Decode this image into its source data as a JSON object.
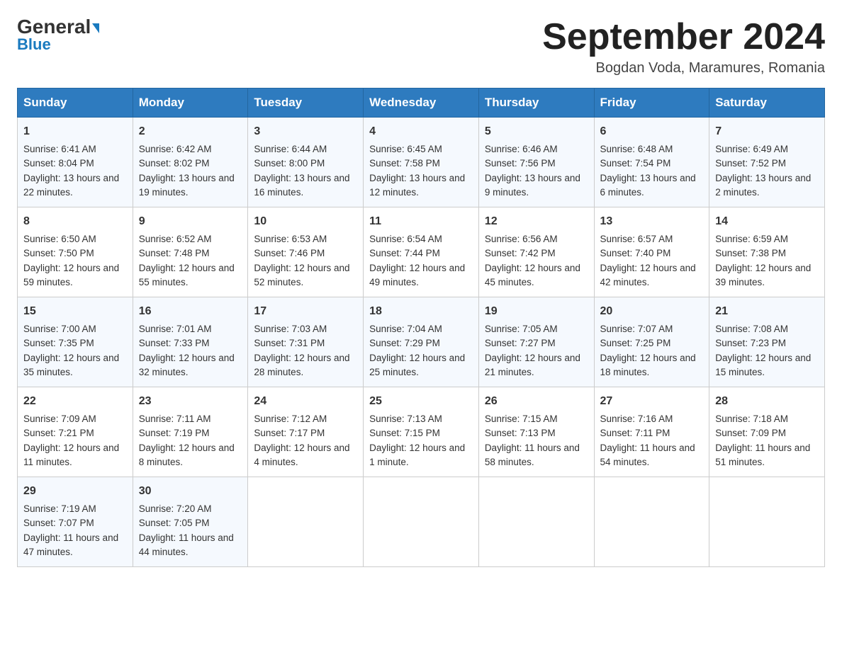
{
  "header": {
    "logo_line1": "General",
    "logo_line2": "Blue",
    "title": "September 2024",
    "subtitle": "Bogdan Voda, Maramures, Romania"
  },
  "days_of_week": [
    "Sunday",
    "Monday",
    "Tuesday",
    "Wednesday",
    "Thursday",
    "Friday",
    "Saturday"
  ],
  "weeks": [
    [
      {
        "day": "1",
        "sunrise": "6:41 AM",
        "sunset": "8:04 PM",
        "daylight": "13 hours and 22 minutes."
      },
      {
        "day": "2",
        "sunrise": "6:42 AM",
        "sunset": "8:02 PM",
        "daylight": "13 hours and 19 minutes."
      },
      {
        "day": "3",
        "sunrise": "6:44 AM",
        "sunset": "8:00 PM",
        "daylight": "13 hours and 16 minutes."
      },
      {
        "day": "4",
        "sunrise": "6:45 AM",
        "sunset": "7:58 PM",
        "daylight": "13 hours and 12 minutes."
      },
      {
        "day": "5",
        "sunrise": "6:46 AM",
        "sunset": "7:56 PM",
        "daylight": "13 hours and 9 minutes."
      },
      {
        "day": "6",
        "sunrise": "6:48 AM",
        "sunset": "7:54 PM",
        "daylight": "13 hours and 6 minutes."
      },
      {
        "day": "7",
        "sunrise": "6:49 AM",
        "sunset": "7:52 PM",
        "daylight": "13 hours and 2 minutes."
      }
    ],
    [
      {
        "day": "8",
        "sunrise": "6:50 AM",
        "sunset": "7:50 PM",
        "daylight": "12 hours and 59 minutes."
      },
      {
        "day": "9",
        "sunrise": "6:52 AM",
        "sunset": "7:48 PM",
        "daylight": "12 hours and 55 minutes."
      },
      {
        "day": "10",
        "sunrise": "6:53 AM",
        "sunset": "7:46 PM",
        "daylight": "12 hours and 52 minutes."
      },
      {
        "day": "11",
        "sunrise": "6:54 AM",
        "sunset": "7:44 PM",
        "daylight": "12 hours and 49 minutes."
      },
      {
        "day": "12",
        "sunrise": "6:56 AM",
        "sunset": "7:42 PM",
        "daylight": "12 hours and 45 minutes."
      },
      {
        "day": "13",
        "sunrise": "6:57 AM",
        "sunset": "7:40 PM",
        "daylight": "12 hours and 42 minutes."
      },
      {
        "day": "14",
        "sunrise": "6:59 AM",
        "sunset": "7:38 PM",
        "daylight": "12 hours and 39 minutes."
      }
    ],
    [
      {
        "day": "15",
        "sunrise": "7:00 AM",
        "sunset": "7:35 PM",
        "daylight": "12 hours and 35 minutes."
      },
      {
        "day": "16",
        "sunrise": "7:01 AM",
        "sunset": "7:33 PM",
        "daylight": "12 hours and 32 minutes."
      },
      {
        "day": "17",
        "sunrise": "7:03 AM",
        "sunset": "7:31 PM",
        "daylight": "12 hours and 28 minutes."
      },
      {
        "day": "18",
        "sunrise": "7:04 AM",
        "sunset": "7:29 PM",
        "daylight": "12 hours and 25 minutes."
      },
      {
        "day": "19",
        "sunrise": "7:05 AM",
        "sunset": "7:27 PM",
        "daylight": "12 hours and 21 minutes."
      },
      {
        "day": "20",
        "sunrise": "7:07 AM",
        "sunset": "7:25 PM",
        "daylight": "12 hours and 18 minutes."
      },
      {
        "day": "21",
        "sunrise": "7:08 AM",
        "sunset": "7:23 PM",
        "daylight": "12 hours and 15 minutes."
      }
    ],
    [
      {
        "day": "22",
        "sunrise": "7:09 AM",
        "sunset": "7:21 PM",
        "daylight": "12 hours and 11 minutes."
      },
      {
        "day": "23",
        "sunrise": "7:11 AM",
        "sunset": "7:19 PM",
        "daylight": "12 hours and 8 minutes."
      },
      {
        "day": "24",
        "sunrise": "7:12 AM",
        "sunset": "7:17 PM",
        "daylight": "12 hours and 4 minutes."
      },
      {
        "day": "25",
        "sunrise": "7:13 AM",
        "sunset": "7:15 PM",
        "daylight": "12 hours and 1 minute."
      },
      {
        "day": "26",
        "sunrise": "7:15 AM",
        "sunset": "7:13 PM",
        "daylight": "11 hours and 58 minutes."
      },
      {
        "day": "27",
        "sunrise": "7:16 AM",
        "sunset": "7:11 PM",
        "daylight": "11 hours and 54 minutes."
      },
      {
        "day": "28",
        "sunrise": "7:18 AM",
        "sunset": "7:09 PM",
        "daylight": "11 hours and 51 minutes."
      }
    ],
    [
      {
        "day": "29",
        "sunrise": "7:19 AM",
        "sunset": "7:07 PM",
        "daylight": "11 hours and 47 minutes."
      },
      {
        "day": "30",
        "sunrise": "7:20 AM",
        "sunset": "7:05 PM",
        "daylight": "11 hours and 44 minutes."
      },
      null,
      null,
      null,
      null,
      null
    ]
  ],
  "labels": {
    "sunrise": "Sunrise:",
    "sunset": "Sunset:",
    "daylight": "Daylight:"
  }
}
